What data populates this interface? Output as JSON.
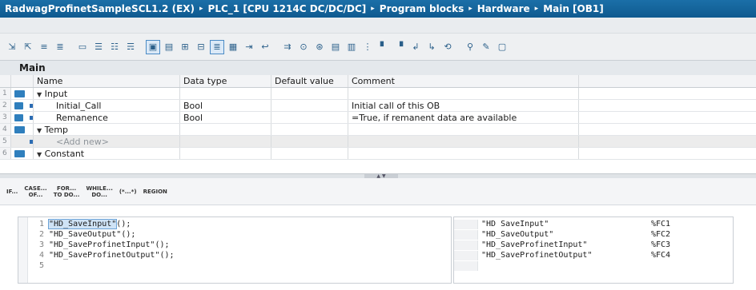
{
  "breadcrumb": [
    "RadwagProfinetSampleSCL1.2 (EX)",
    "PLC_1 [CPU 1214C DC/DC/DC]",
    "Program blocks",
    "Hardware",
    "Main [OB1]"
  ],
  "breadcrumb_separator": "▸",
  "block": {
    "title": "Main"
  },
  "columns": {
    "name": "Name",
    "data_type": "Data type",
    "default_value": "Default value",
    "comment": "Comment"
  },
  "rows": [
    {
      "num": "1",
      "name": "Input",
      "data_type": "",
      "default_value": "",
      "comment": ""
    },
    {
      "num": "2",
      "name": "Initial_Call",
      "data_type": "Bool",
      "default_value": "",
      "comment": "Initial call of this OB"
    },
    {
      "num": "3",
      "name": "Remanence",
      "data_type": "Bool",
      "default_value": "",
      "comment": "=True, if remanent data are available"
    },
    {
      "num": "4",
      "name": "Temp",
      "data_type": "",
      "default_value": "",
      "comment": ""
    },
    {
      "num": "5",
      "name": "<Add new>",
      "data_type": "",
      "default_value": "",
      "comment": ""
    },
    {
      "num": "6",
      "name": "Constant",
      "data_type": "",
      "default_value": "",
      "comment": ""
    }
  ],
  "scl_instructions": [
    {
      "l1": "IF...",
      "l2": ""
    },
    {
      "l1": "CASE...",
      "l2": "OF..."
    },
    {
      "l1": "FOR...",
      "l2": "TO DO..."
    },
    {
      "l1": "WHILE...",
      "l2": "DO..."
    },
    {
      "l1": "(*...*)",
      "l2": ""
    },
    {
      "l1": "REGION",
      "l2": ""
    }
  ],
  "code_lines": [
    {
      "num": "1",
      "call": "\"HD_SaveInput\"",
      "rest": "();"
    },
    {
      "num": "2",
      "call": "\"HD_SaveOutput\"",
      "rest": "();"
    },
    {
      "num": "3",
      "call": "\"HD_SaveProfinetInput\"",
      "rest": "();"
    },
    {
      "num": "4",
      "call": "\"HD_SaveProfinetOutput\"",
      "rest": "();"
    },
    {
      "num": "5",
      "call": "",
      "rest": ""
    }
  ],
  "cross_reference": [
    {
      "name": "\"HD SaveInput\"",
      "address": "%FC1"
    },
    {
      "name": "\"HD_SaveOutput\"",
      "address": "%FC2"
    },
    {
      "name": "\"HD_SaveProfinetInput\"",
      "address": "%FC3"
    },
    {
      "name": "\"HD_SaveProfinetOutput\"",
      "address": "%FC4"
    },
    {
      "name": "",
      "address": ""
    }
  ],
  "toolbar_icons": [
    "insert-network-icon",
    "delete-network-icon",
    "insert-row-icon",
    "add-row-icon",
    "watch-icon",
    "align-left-icon",
    "align-center-icon",
    "align-right-icon",
    "comment-icon",
    "indent-icon",
    "outdent-icon",
    "list-icon",
    "fb-icon",
    "call-icon",
    "open-block-icon",
    "goto-icon",
    "compare-icon",
    "breakpoint-icon",
    "step-icon",
    "next-icon",
    "mark-icon",
    "jump-icon",
    "flag-icon",
    "flag2-icon",
    "monitor-icon",
    "monitor-all-icon",
    "repeat-icon",
    "link-icon",
    "pen-icon",
    "stop-icon"
  ],
  "colors": {
    "title_bar": "#1b6fa8",
    "interface_icon": "#2f7fbd",
    "selection": "#cfe3f6"
  }
}
